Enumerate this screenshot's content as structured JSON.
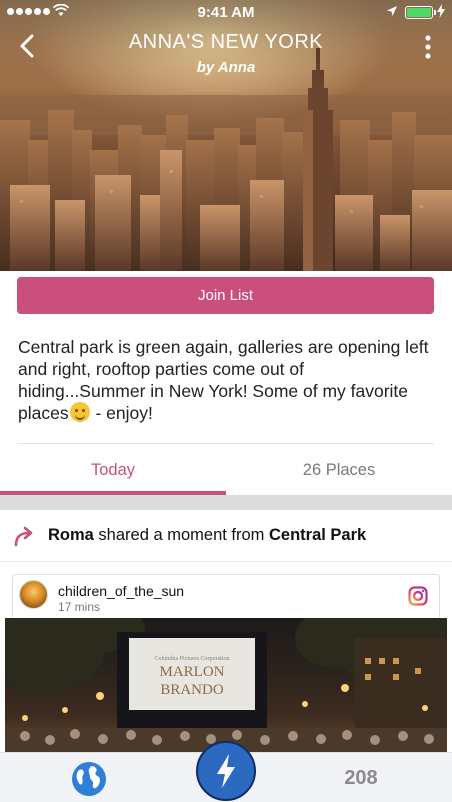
{
  "status_bar": {
    "time": "9:41 AM"
  },
  "header": {
    "title": "ANNA'S NEW YORK",
    "byline": "by Anna"
  },
  "join_button": {
    "label": "Join List"
  },
  "description": {
    "text_before_emoji": "Central park is green again, galleries are opening left and right, rooftop parties come out of hiding...Summer in New York! Some of my favorite places",
    "text_after_emoji": " - enjoy!"
  },
  "tabs": [
    {
      "label": "Today",
      "active": true
    },
    {
      "label": "26 Places",
      "active": false
    }
  ],
  "moment": {
    "sharer": "Roma",
    "action": " shared a moment from ",
    "place": "Central Park"
  },
  "post": {
    "username": "children_of_the_sun",
    "time_ago": "17 mins",
    "screen_text_line1": "MARLON",
    "screen_text_line2": "BRANDO"
  },
  "bottom_bar": {
    "count": "208"
  },
  "colors": {
    "accent": "#c94f7c",
    "bolt_button": "#2c6ac2",
    "globe": "#2f7fd8"
  }
}
